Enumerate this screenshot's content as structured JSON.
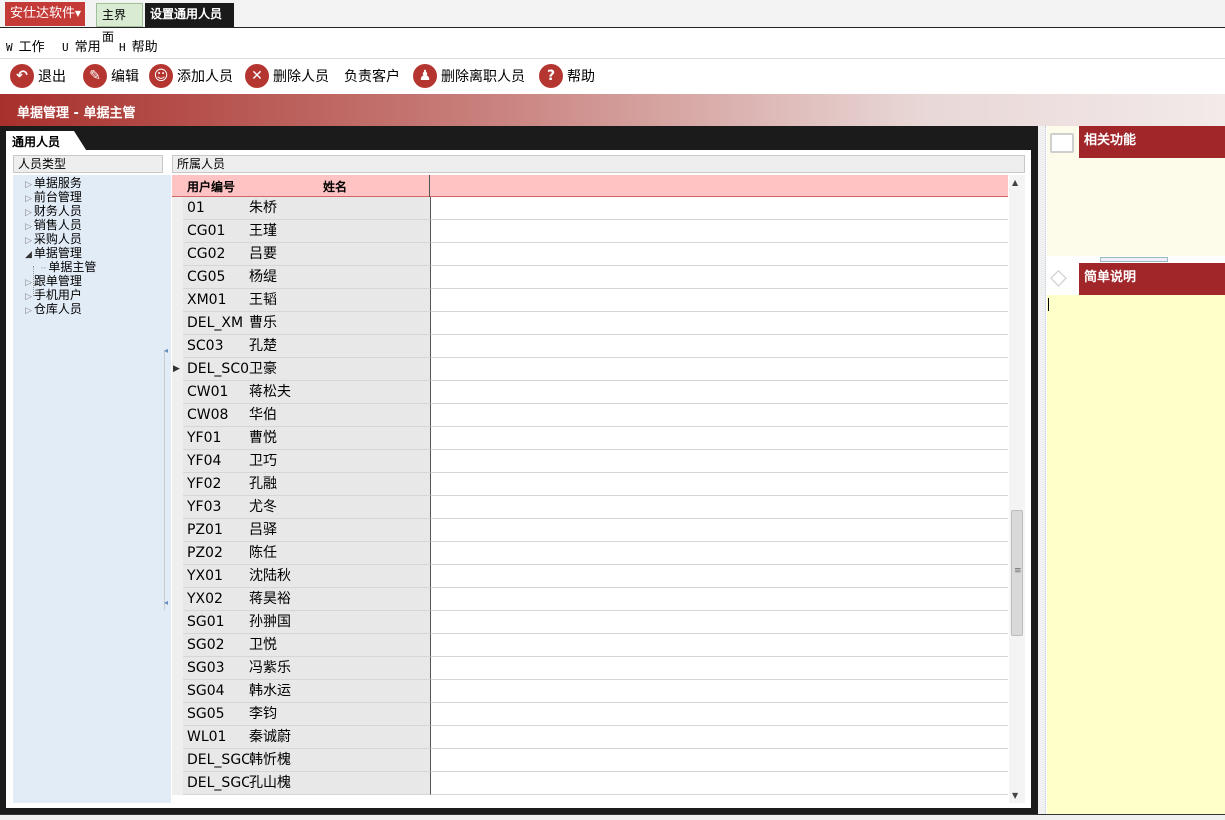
{
  "topbar": {
    "brand": "安仕达软件",
    "tabs": [
      "主界面",
      "设置通用人员"
    ]
  },
  "menu": [
    {
      "key": "W",
      "label": "工作"
    },
    {
      "key": "U",
      "label": "常用"
    },
    {
      "key": "H",
      "label": "帮助"
    }
  ],
  "toolbar": {
    "exit": "退出",
    "edit": "编辑",
    "add_person": "添加人员",
    "delete_person": "删除人员",
    "customers": "负责客户",
    "delete_resigned": "删除离职人员",
    "help": "帮助"
  },
  "banner": {
    "title": "单据管理 - 单据主管"
  },
  "inner_tab": "通用人员",
  "tree": {
    "header": "人员类型",
    "nodes": [
      "单据服务",
      "前台管理",
      "财务人员",
      "销售人员",
      "采购人员",
      "单据管理",
      "单据主管",
      "跟单管理",
      "手机用户",
      "仓库人员"
    ]
  },
  "grid": {
    "header": "所属人员",
    "columns": [
      "用户编号",
      "姓名"
    ],
    "rows": [
      {
        "id": "01",
        "name": "朱桥"
      },
      {
        "id": "CG01",
        "name": "王瑾"
      },
      {
        "id": "CG02",
        "name": "吕要"
      },
      {
        "id": "CG05",
        "name": "杨缇"
      },
      {
        "id": "XM01",
        "name": "王韬"
      },
      {
        "id": "DEL_XM",
        "name": "曹乐"
      },
      {
        "id": "SC03",
        "name": "孔楚"
      },
      {
        "id": "DEL_SC0",
        "name": "卫豪"
      },
      {
        "id": "CW01",
        "name": "蒋松夫"
      },
      {
        "id": "CW08",
        "name": "华伯"
      },
      {
        "id": "YF01",
        "name": "曹悦"
      },
      {
        "id": "YF04",
        "name": "卫巧"
      },
      {
        "id": "YF02",
        "name": "孔融"
      },
      {
        "id": "YF03",
        "name": "尤冬"
      },
      {
        "id": "PZ01",
        "name": "吕驿"
      },
      {
        "id": "PZ02",
        "name": "陈任"
      },
      {
        "id": "YX01",
        "name": "沈陆秋"
      },
      {
        "id": "YX02",
        "name": "蒋昊裕"
      },
      {
        "id": "SG01",
        "name": "孙翀国"
      },
      {
        "id": "SG02",
        "name": "卫悦"
      },
      {
        "id": "SG03",
        "name": "冯紫乐"
      },
      {
        "id": "SG04",
        "name": "韩水运"
      },
      {
        "id": "SG05",
        "name": "李钧"
      },
      {
        "id": "WL01",
        "name": "秦诚蔚"
      },
      {
        "id": "DEL_SGC",
        "name": "韩忻槐"
      },
      {
        "id": "DEL_SGC",
        "name": "孔山槐"
      }
    ]
  },
  "right_panel": {
    "related": "相关功能",
    "description": "简单说明"
  }
}
